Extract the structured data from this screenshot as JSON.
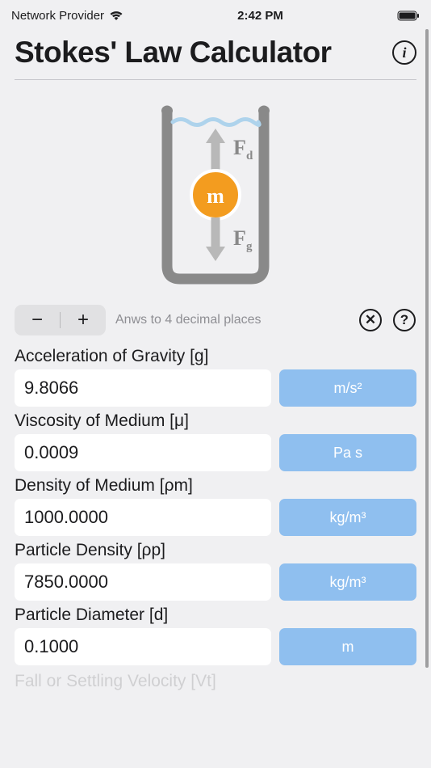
{
  "status_bar": {
    "carrier": "Network Provider",
    "time": "2:42 PM"
  },
  "header": {
    "title": "Stokes' Law Calculator",
    "info_label": "i"
  },
  "diagram": {
    "force_up_label": "F",
    "force_up_sub": "d",
    "force_down_label": "F",
    "force_down_sub": "g",
    "mass_label": "m"
  },
  "controls": {
    "minus": "−",
    "plus": "+",
    "precision_text": "Anws to 4 decimal places",
    "clear_symbol": "✕",
    "help_symbol": "?"
  },
  "fields": [
    {
      "label": "Acceleration of Gravity [g]",
      "value": "9.8066",
      "unit": "m/s²",
      "name": "gravity"
    },
    {
      "label": "Viscosity of Medium [μ]",
      "value": "0.0009",
      "unit": "Pa s",
      "name": "viscosity"
    },
    {
      "label": "Density of Medium [ρm]",
      "value": "1000.0000",
      "unit": "kg/m³",
      "name": "density-medium"
    },
    {
      "label": "Particle Density [ρp]",
      "value": "7850.0000",
      "unit": "kg/m³",
      "name": "density-particle"
    },
    {
      "label": "Particle Diameter [d]",
      "value": "0.1000",
      "unit": "m",
      "name": "diameter"
    }
  ],
  "partial_next_label": "Fall or Settling Velocity [Vt]"
}
